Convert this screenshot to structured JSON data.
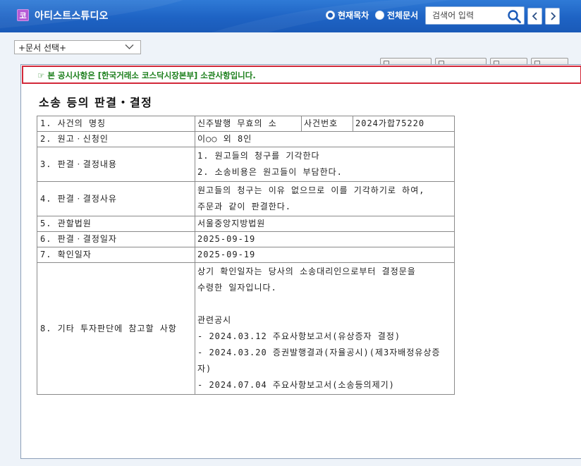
{
  "app": {
    "logo_glyph": "코",
    "title": "아티스트스튜디오"
  },
  "search_scope": {
    "current_label": "현재목차",
    "all_label": "전체문서",
    "selected": "현재목차"
  },
  "search": {
    "placeholder": "검색어 입력"
  },
  "toolbar": {
    "doc_select_value": "+문서 선택+"
  },
  "notice": {
    "text": "☞ 본 공시사항은 [한국거래소 코스닥시장본부] 소관사항입니다."
  },
  "document": {
    "title": "소송 등의 판결・결정",
    "rows": {
      "case_name_label": "1. 사건의 명칭",
      "case_name_value": "신주발행 무효의 소",
      "case_no_label": "사건번호",
      "case_no_value": "2024가합75220",
      "plaintiff_label": "2. 원고ㆍ신청인",
      "plaintiff_value": "이○○ 외 8인",
      "ruling_label": "3. 판결ㆍ결정내용",
      "ruling_lines": [
        "1. 원고들의 청구를 기각한다",
        "2. 소송비용은 원고들이 부담한다."
      ],
      "reason_label": "4. 판결ㆍ결정사유",
      "reason_lines": [
        "원고들의 청구는 이유 없으므로 이를 기각하기로 하여,",
        "주문과 같이 판결한다."
      ],
      "court_label": "5. 관할법원",
      "court_value": "서울중앙지방법원",
      "ruling_date_label": "6. 판결ㆍ결정일자",
      "ruling_date_value": "2025-09-19",
      "confirm_date_label": "7. 확인일자",
      "confirm_date_value": "2025-09-19",
      "other_label": "8. 기타 투자판단에 참고할 사항",
      "other_intro_lines": [
        "상기 확인일자는 당사의 소송대리인으로부터 결정문을",
        "수령한 일자입니다."
      ],
      "related_heading": "관련공시",
      "related_items": [
        "- 2024.03.12 주요사항보고서(유상증자 결정)",
        "- 2024.03.20 증권발행결과(자율공시)(제3자배정유상증자)",
        "- 2024.07.04 주요사항보고서(소송등의제기)"
      ]
    }
  },
  "colors": {
    "header_blue": "#1e63c4",
    "notice_border": "#d2283a",
    "notice_text": "#1a7e1a",
    "logo_purple": "#b65bd6"
  }
}
